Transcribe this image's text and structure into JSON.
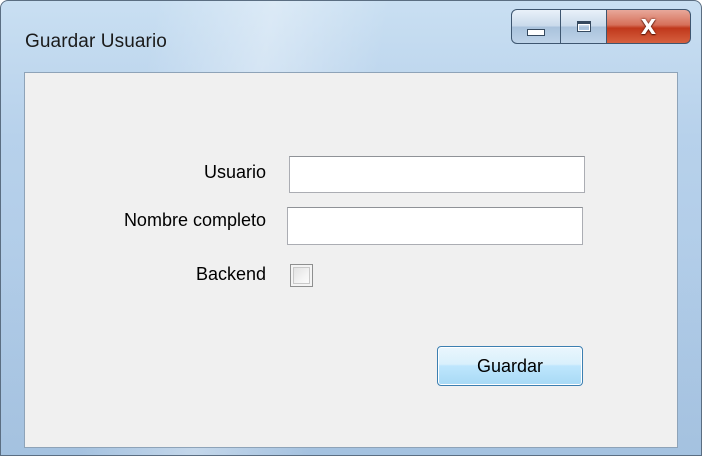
{
  "window": {
    "title": "Guardar Usuario",
    "caption": {
      "minimize_icon": "minimize-icon",
      "maximize_icon": "maximize-icon",
      "close_icon": "close-icon",
      "close_glyph": "X"
    }
  },
  "form": {
    "usuario_label": "Usuario",
    "usuario_value": "",
    "nombre_label": "Nombre completo",
    "nombre_value": "",
    "backend_label": "Backend",
    "backend_checked": false,
    "save_label": "Guardar"
  },
  "colors": {
    "client_background": "#f0f0f0",
    "close_button": "#c0381c",
    "default_button_border": "#3c7fb1"
  }
}
